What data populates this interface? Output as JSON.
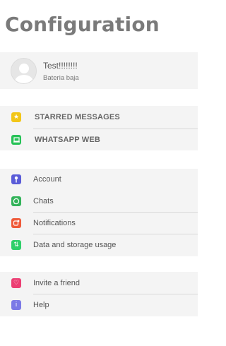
{
  "header": {
    "title": "Configuration"
  },
  "profile": {
    "name": "Test!!!!!!!!",
    "status": "Bateria baja"
  },
  "group1": [
    {
      "label": "STARRED MESSAGES",
      "icon": "star-icon",
      "color": "#f2c618"
    },
    {
      "label": "WHATSAPP WEB",
      "icon": "laptop-icon",
      "color": "#27c257"
    }
  ],
  "group2": [
    {
      "label": "Account",
      "icon": "key-icon",
      "color": "#5a5cd8"
    },
    {
      "label": "Chats",
      "icon": "whatsapp-icon",
      "color": "#33b35a"
    },
    {
      "label": "Notifications",
      "icon": "notification-icon",
      "color": "#ef5a3a"
    },
    {
      "label": "Data and storage usage",
      "icon": "arrows-updown-icon",
      "color": "#2fcf6a"
    }
  ],
  "group3": [
    {
      "label": "Invite a friend",
      "icon": "heart-icon",
      "color": "#ec3f73"
    },
    {
      "label": "Help",
      "icon": "info-icon",
      "color": "#7b79e6"
    }
  ]
}
